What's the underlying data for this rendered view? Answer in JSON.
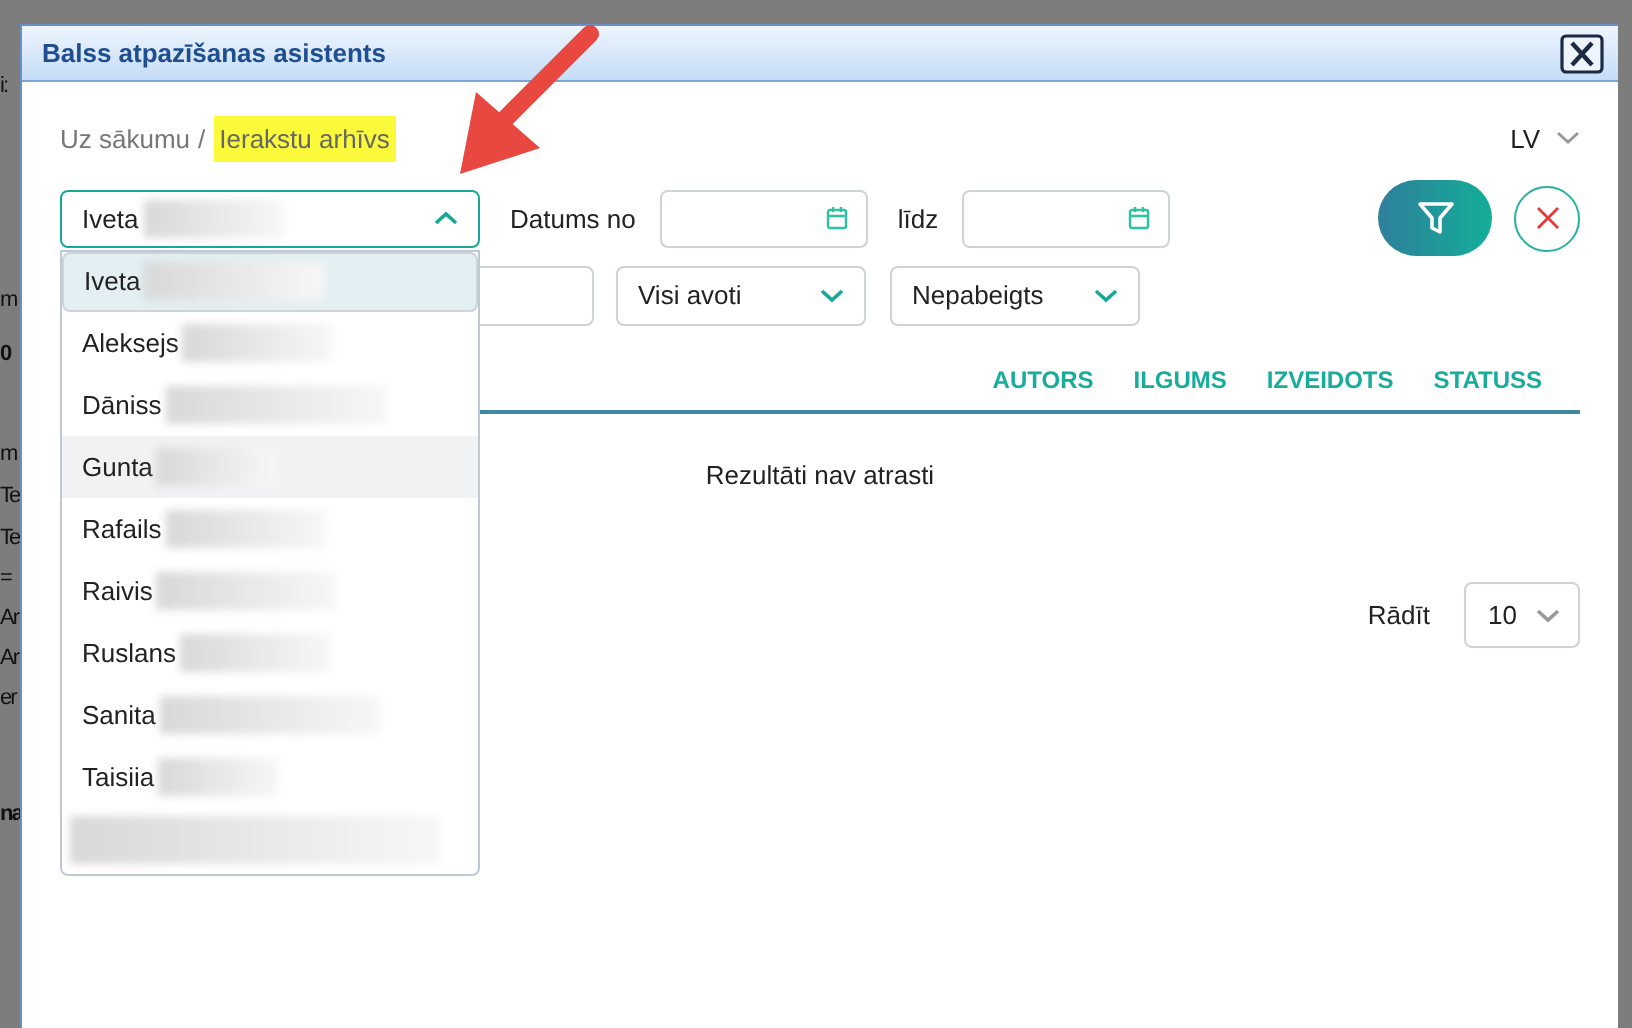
{
  "backdrop": {
    "fragments": [
      "i:",
      "m",
      "0",
      "m",
      "Te",
      "Te",
      "=",
      "Ar",
      "Ar",
      "er",
      "na"
    ]
  },
  "window": {
    "title": "Balss atpazīšanas asistents"
  },
  "breadcrumb": {
    "separator": "/",
    "items": [
      {
        "label": "Uz sākumu",
        "highlighted": false
      },
      {
        "label": "Ierakstu arhīvs",
        "highlighted": true
      }
    ]
  },
  "language": "LV",
  "filters": {
    "author": {
      "value": "Iveta",
      "expanded": true,
      "options": [
        {
          "kind": "name",
          "label": "Iveta",
          "selected": true,
          "hovered": false
        },
        {
          "kind": "name",
          "label": "Aleksejs",
          "selected": false,
          "hovered": false
        },
        {
          "kind": "name",
          "label": "Dāniss",
          "selected": false,
          "hovered": false
        },
        {
          "kind": "name",
          "label": "Gunta",
          "selected": false,
          "hovered": true
        },
        {
          "kind": "name",
          "label": "Rafails",
          "selected": false,
          "hovered": false
        },
        {
          "kind": "name",
          "label": "Raivis",
          "selected": false,
          "hovered": false
        },
        {
          "kind": "name",
          "label": "Ruslans",
          "selected": false,
          "hovered": false
        },
        {
          "kind": "name",
          "label": "Sanita",
          "selected": false,
          "hovered": false
        },
        {
          "kind": "name",
          "label": "Taisiia",
          "selected": false,
          "hovered": false
        },
        {
          "kind": "redacted",
          "selected": false,
          "hovered": false
        }
      ]
    },
    "date_from_label": "Datums no",
    "date_to_label": "līdz",
    "source": "Visi avoti",
    "status": "Nepabeigts"
  },
  "table": {
    "columns": [
      "AUTORS",
      "ILGUMS",
      "IZVEIDOTS",
      "STATUSS"
    ],
    "empty_message": "Rezultāti nav atrasti"
  },
  "page_size": {
    "label": "Rādīt",
    "value": "10"
  }
}
